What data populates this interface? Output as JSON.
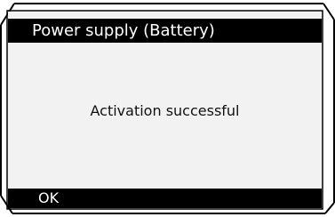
{
  "screen": {
    "title": "Power supply (Battery)",
    "message": "Activation successful",
    "softkeys": {
      "ok_label": "OK"
    }
  },
  "colors": {
    "bar_background": "#000000",
    "bar_text": "#ffffff",
    "panel_background": "#f2f2f2",
    "message_text": "#111111"
  }
}
